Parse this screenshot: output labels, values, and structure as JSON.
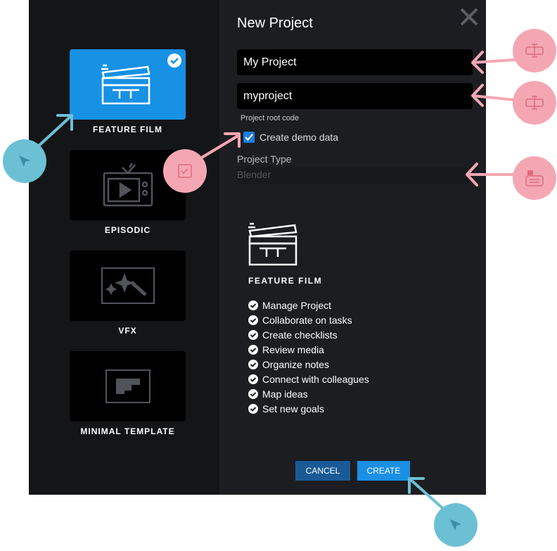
{
  "colors": {
    "accent": "#1791e4",
    "cancel": "#1a5a96",
    "annotation_pink": "#f4a7b3",
    "annotation_teal": "#6cc0d4"
  },
  "templates": [
    {
      "label": "FEATURE FILM",
      "icon": "clapperboard-icon",
      "selected": true
    },
    {
      "label": "EPISODIC",
      "icon": "tv-icon",
      "selected": false
    },
    {
      "label": "VFX",
      "icon": "magic-wand-icon",
      "selected": false
    },
    {
      "label": "MINIMAL TEMPLATE",
      "icon": "layout-icon",
      "selected": false
    }
  ],
  "dialog": {
    "title": "New Project",
    "project_name": "My Project",
    "project_code": "myproject",
    "project_code_hint": "Project root code",
    "demo_data_label": "Create demo data",
    "demo_data_checked": true,
    "project_type_label": "Project Type",
    "project_type_value": "Blender"
  },
  "preview": {
    "title": "FEATURE FILM",
    "features": [
      "Manage Project",
      "Collaborate on tasks",
      "Create checklists",
      "Review media",
      "Organize notes",
      "Connect with colleagues",
      "Map ideas",
      "Set new goals"
    ]
  },
  "buttons": {
    "cancel": "CANCEL",
    "create": "CREATE"
  }
}
